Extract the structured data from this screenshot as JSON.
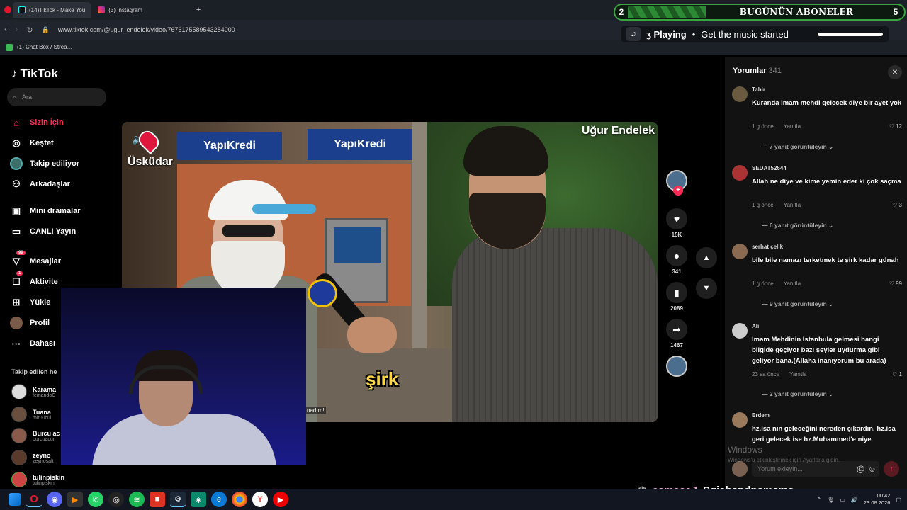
{
  "browser": {
    "tabs": [
      {
        "label": "(14)TikTok - Make You",
        "active": true
      },
      {
        "label": "(3) Instagram",
        "active": false
      }
    ],
    "new_tab_label": "+",
    "url": "www.tiktok.com/@ugur_endelek/video/7676175589543284000",
    "bookmark": "(1) Chat Box / Strea..."
  },
  "overlay": {
    "sub_count": "2",
    "sub_title": "BUGÜNÜN ABONELER",
    "sub_tail": "5",
    "music_prefix": "ʒ Playing",
    "music_text": "Get the music started"
  },
  "sidebar": {
    "logo": "TikTok",
    "search_placeholder": "Ara",
    "items": [
      {
        "label": "Sizin İçin",
        "icon": "home-icon"
      },
      {
        "label": "Keşfet",
        "icon": "compass-icon"
      },
      {
        "label": "Takip ediliyor",
        "icon": "following-icon"
      },
      {
        "label": "Arkadaşlar",
        "icon": "friends-icon"
      },
      {
        "label": "Mini dramalar",
        "icon": "drama-icon"
      },
      {
        "label": "CANLI Yayın",
        "icon": "live-icon"
      },
      {
        "label": "Mesajlar",
        "icon": "messages-icon",
        "badge": "99"
      },
      {
        "label": "Aktivite",
        "icon": "activity-icon",
        "badge": "1"
      },
      {
        "label": "Yükle",
        "icon": "upload-icon"
      },
      {
        "label": "Profil",
        "icon": "profile-icon"
      },
      {
        "label": "Dahası",
        "icon": "more-icon"
      }
    ],
    "following_title": "Takip edilen he",
    "following": [
      {
        "name": "Karama",
        "user": "femandoC"
      },
      {
        "name": "Tuana",
        "user": "mir00cul"
      },
      {
        "name": "Burcu ac",
        "user": "burcuacur"
      },
      {
        "name": "zeyno",
        "user": "zeynosalt"
      },
      {
        "name": "tulinpiskin",
        "user": "tulinpiskin"
      }
    ]
  },
  "video": {
    "location": "Üsküdar",
    "creator": "Uğur Endelek",
    "bank1": "YapıKredi",
    "bank2": "YapıKredi",
    "caption": "şirk",
    "subtitle": "nadım!"
  },
  "actions": {
    "likes": "15K",
    "comments": "341",
    "saves": "2089",
    "shares": "1467"
  },
  "comments": {
    "title": "Yorumlar",
    "count": "341",
    "reply_label": "Yanıtla",
    "items": [
      {
        "user": "Tahir",
        "text": "Kuranda imam mehdi gelecek diye bir ayet yok",
        "time": "1 g önce",
        "likes": "12",
        "replies": "7 yanıt görüntüleyin"
      },
      {
        "user": "SEDAT52644",
        "text": "Allah ne diye ve kime yemin eder ki çok saçma",
        "time": "1 g önce",
        "likes": "3",
        "replies": "6 yanıt görüntüleyin"
      },
      {
        "user": "serhat çelik",
        "text": "bile bile namazı terketmek te şirk kadar günah",
        "time": "1 g önce",
        "likes": "99",
        "replies": "9 yanıt görüntüleyin"
      },
      {
        "user": "Ali",
        "text": "İmam Mehdinin İstanbula gelmesi hangi bilgide geçiyor bazı şeyler uydurma gibi geliyor bana.(Allaha inanıyorum bu arada)",
        "time": "23 sa önce",
        "likes": "1",
        "replies": "2 yanıt görüntüleyin"
      },
      {
        "user": "Erdem",
        "text": "hz.isa nın geleceğini nereden çıkardın. hz.isa geri gelecek ise hz.Muhammed'e niye",
        "time": "",
        "likes": "",
        "replies": ""
      }
    ],
    "input_placeholder": "Yorum ekleyin..."
  },
  "windows": {
    "activate": "Windows",
    "activate_sub": "Windows'u etkinleştirmek için Ayarlar'a gidin."
  },
  "stream": {
    "name1": "esmaaaJ",
    "name2": "Sgjsbsndnsmsms"
  },
  "taskbar": {
    "time": "00:42",
    "date": "23.08.2026"
  }
}
